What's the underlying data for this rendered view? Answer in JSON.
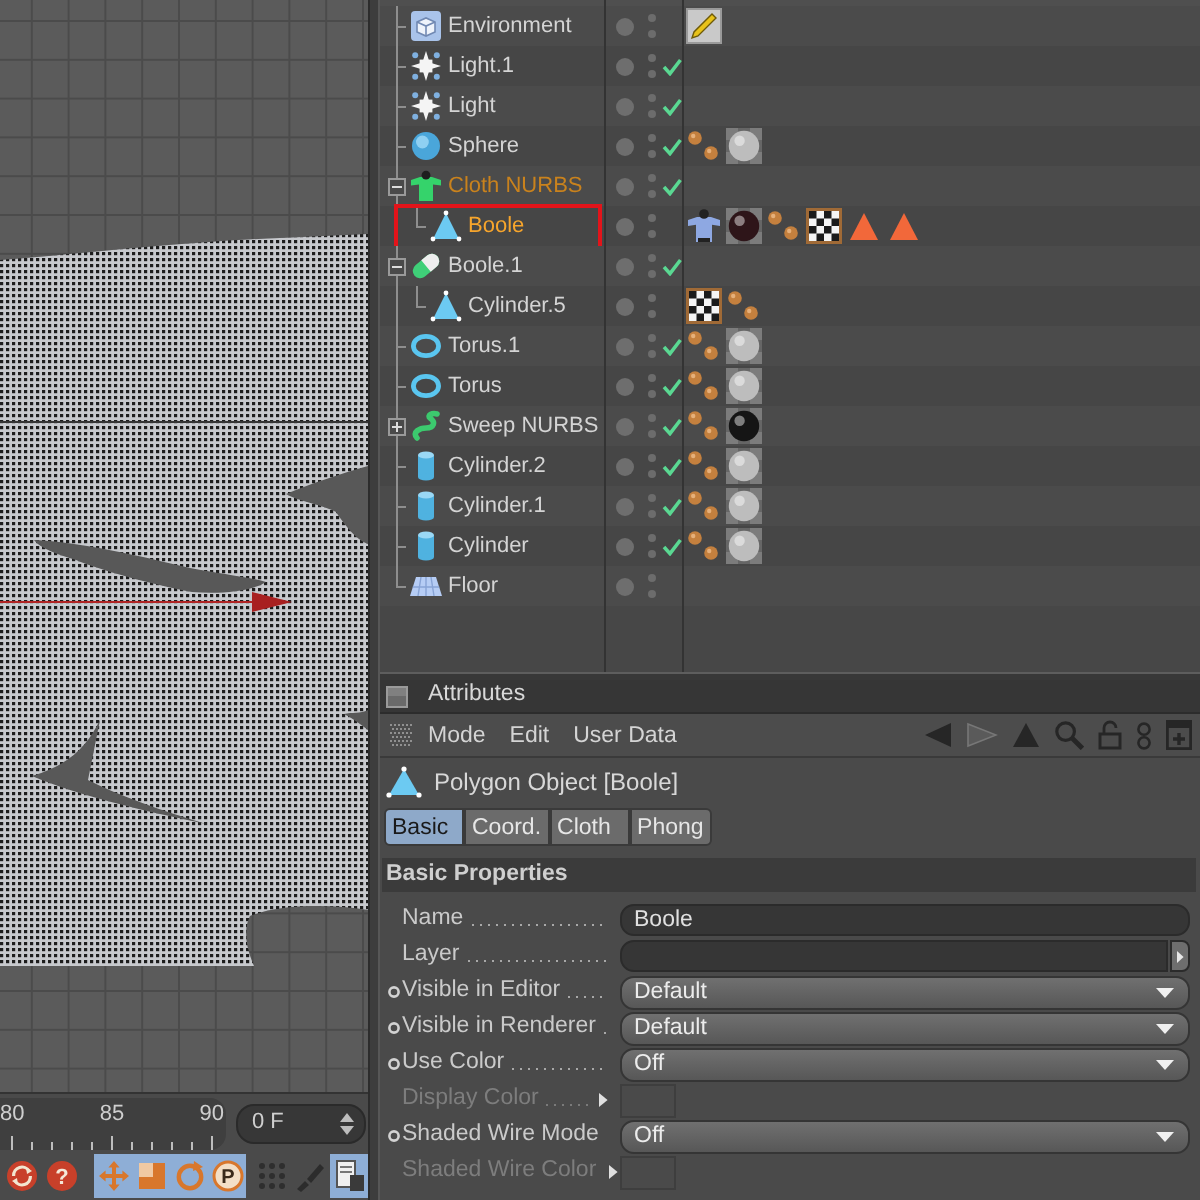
{
  "viewport": {
    "timeline": {
      "labels": [
        "80",
        "85",
        "90"
      ],
      "frame_field": "0 F"
    },
    "toolbar": [
      {
        "kind": "keys",
        "on": false
      },
      {
        "kind": "help",
        "glyph": "?",
        "on": false
      },
      {
        "kind": "move",
        "on": true
      },
      {
        "kind": "scale",
        "on": true
      },
      {
        "kind": "rotate",
        "on": true
      },
      {
        "kind": "param",
        "glyph": "P",
        "on": true
      },
      {
        "kind": "points",
        "on": false
      },
      {
        "kind": "brush",
        "on": false
      },
      {
        "kind": "layout",
        "on": true
      }
    ]
  },
  "object_manager": {
    "objects": [
      {
        "name": "Environment",
        "kind": "environment",
        "checked": false,
        "selected": false,
        "active": false,
        "highlighted": false,
        "tags": [
          {
            "kind": "pencil"
          }
        ]
      },
      {
        "name": "Light.1",
        "kind": "light",
        "checked": true,
        "selected": false,
        "active": false,
        "highlighted": false
      },
      {
        "name": "Light",
        "kind": "light",
        "checked": true,
        "selected": false,
        "active": false,
        "highlighted": false
      },
      {
        "name": "Sphere",
        "kind": "sphere",
        "checked": true,
        "selected": false,
        "active": false,
        "highlighted": false,
        "tags": [
          {
            "kind": "phong"
          },
          {
            "kind": "material",
            "color": "#bdbdbd"
          }
        ]
      },
      {
        "name": "Cloth NURBS",
        "kind": "cloth",
        "checked": true,
        "selected": true,
        "active": false,
        "highlighted": false,
        "expanded": true,
        "children": [
          {
            "name": "Boole",
            "kind": "polygon",
            "checked": false,
            "selected": true,
            "active": true,
            "highlighted": true,
            "tags": [
              {
                "kind": "cloth"
              },
              {
                "kind": "material",
                "color": "#2e1519"
              },
              {
                "kind": "phong"
              },
              {
                "kind": "checker"
              },
              {
                "kind": "selection"
              },
              {
                "kind": "selection"
              }
            ]
          }
        ]
      },
      {
        "name": "Boole.1",
        "kind": "boole",
        "checked": true,
        "selected": false,
        "active": false,
        "highlighted": false,
        "expanded": true,
        "children": [
          {
            "name": "Cylinder.5",
            "kind": "polygon",
            "checked": false,
            "selected": false,
            "active": false,
            "highlighted": false,
            "tags": [
              {
                "kind": "checker"
              },
              {
                "kind": "phong"
              }
            ]
          }
        ]
      },
      {
        "name": "Torus.1",
        "kind": "torus",
        "checked": true,
        "selected": false,
        "active": false,
        "highlighted": false,
        "tags": [
          {
            "kind": "phong"
          },
          {
            "kind": "material",
            "color": "#bdbdbd"
          }
        ]
      },
      {
        "name": "Torus",
        "kind": "torus",
        "checked": true,
        "selected": false,
        "active": false,
        "highlighted": false,
        "tags": [
          {
            "kind": "phong"
          },
          {
            "kind": "material",
            "color": "#bdbdbd"
          }
        ]
      },
      {
        "name": "Sweep NURBS",
        "kind": "sweep",
        "checked": true,
        "selected": false,
        "active": false,
        "highlighted": false,
        "expanded": false,
        "tags": [
          {
            "kind": "phong"
          },
          {
            "kind": "material",
            "color": "#151515"
          }
        ]
      },
      {
        "name": "Cylinder.2",
        "kind": "cylinder",
        "checked": true,
        "selected": false,
        "active": false,
        "highlighted": false,
        "tags": [
          {
            "kind": "phong"
          },
          {
            "kind": "material",
            "color": "#bdbdbd"
          }
        ]
      },
      {
        "name": "Cylinder.1",
        "kind": "cylinder",
        "checked": true,
        "selected": false,
        "active": false,
        "highlighted": false,
        "tags": [
          {
            "kind": "phong"
          },
          {
            "kind": "material",
            "color": "#bdbdbd"
          }
        ]
      },
      {
        "name": "Cylinder",
        "kind": "cylinder",
        "checked": true,
        "selected": false,
        "active": false,
        "highlighted": false,
        "tags": [
          {
            "kind": "phong"
          },
          {
            "kind": "material",
            "color": "#bdbdbd"
          }
        ]
      },
      {
        "name": "Floor",
        "kind": "floor",
        "checked": false,
        "selected": false,
        "active": false,
        "highlighted": false
      }
    ]
  },
  "attributes": {
    "title": "Attributes",
    "menu": [
      "Mode",
      "Edit",
      "User Data"
    ],
    "object_title": "Polygon Object [Boole]",
    "tabs": [
      {
        "label": "Basic",
        "selected": true
      },
      {
        "label": "Coord.",
        "selected": false
      },
      {
        "label": "Cloth",
        "selected": false
      },
      {
        "label": "Phong",
        "selected": false
      }
    ],
    "section": "Basic Properties",
    "properties": [
      {
        "label": "Name",
        "kind": "text",
        "value": "Boole",
        "animatable": false,
        "disabled": false
      },
      {
        "label": "Layer",
        "kind": "layer",
        "animatable": false,
        "disabled": false
      },
      {
        "label": "Visible in Editor",
        "kind": "dropdown",
        "value": "Default",
        "animatable": true,
        "disabled": false
      },
      {
        "label": "Visible in Renderer",
        "kind": "dropdown",
        "value": "Default",
        "animatable": true,
        "disabled": false
      },
      {
        "label": "Use Color",
        "kind": "dropdown",
        "value": "Off",
        "animatable": true,
        "disabled": false
      },
      {
        "label": "Display Color",
        "kind": "color",
        "animatable": false,
        "disabled": true
      },
      {
        "label": "Shaded Wire Mode",
        "kind": "dropdown",
        "value": "Off",
        "animatable": true,
        "disabled": false
      },
      {
        "label": "Shaded Wire Color",
        "kind": "color",
        "animatable": false,
        "disabled": true
      }
    ]
  }
}
